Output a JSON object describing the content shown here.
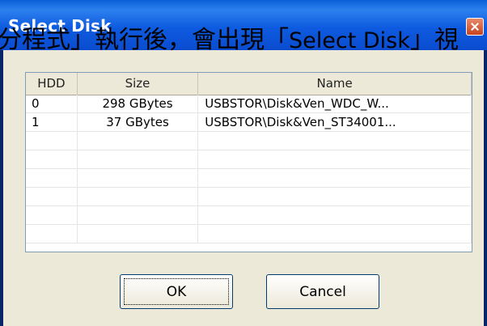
{
  "window": {
    "title": "Select Disk",
    "close_icon": "close-icon"
  },
  "caption": {
    "prefix": "分程式」執行後，會出現「",
    "highlight": "Select Disk",
    "suffix": "」視"
  },
  "list": {
    "columns": [
      "HDD",
      "Size",
      "Name"
    ],
    "rows": [
      {
        "hdd": "0",
        "size": "298 GBytes",
        "name": "USBSTOR\\Disk&Ven_WDC_W..."
      },
      {
        "hdd": "1",
        "size": "37 GBytes",
        "name": "USBSTOR\\Disk&Ven_ST34001..."
      }
    ],
    "empty_rows": 6
  },
  "buttons": {
    "ok": "OK",
    "cancel": "Cancel"
  },
  "colors": {
    "titlebar": "#0a5fd8",
    "close_button": "#d05a35",
    "dialog_bg": "#ece9d8"
  }
}
